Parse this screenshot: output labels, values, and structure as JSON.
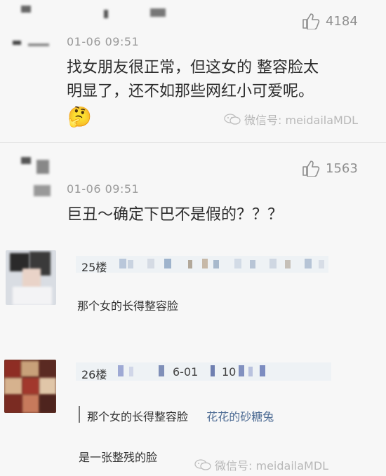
{
  "comment1": {
    "timestamp": "01-06 09:51",
    "text_line1": "找女朋友很正常，但这女的 整容脸太",
    "text_line2": "明显了，还不如那些网红小可爱呢。",
    "emoji": "🤔",
    "likes": "4184"
  },
  "comment2": {
    "timestamp": "01-06 09:51",
    "text": "巨丑～确定下巴不是假的？？？",
    "likes": "1563"
  },
  "reply1": {
    "floor": "25楼",
    "text": "那个女的长得整容脸"
  },
  "reply2": {
    "floor": "26楼",
    "header_fragment_date": "6-01",
    "header_fragment_num": "10",
    "quote_text": "那个女的长得整容脸",
    "quote_user": "花花的砂糖兔",
    "text": "是一张整残的脸"
  },
  "watermark": {
    "text": "微信号: meidailaMDL",
    "icon": "wechat-icon"
  },
  "icons": {
    "like": "thumbs-up-icon"
  }
}
